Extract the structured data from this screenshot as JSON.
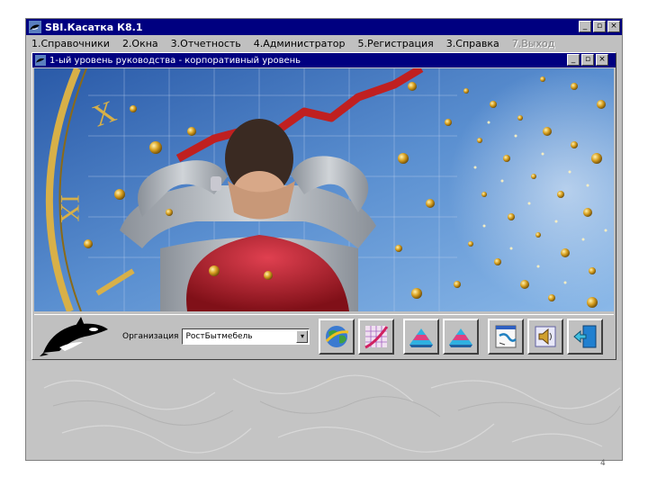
{
  "app": {
    "title": "SBI.Касатка К8.1",
    "window_controls": [
      "_",
      "▫",
      "×"
    ]
  },
  "menu": [
    {
      "label": "1.Справочники",
      "enabled": true
    },
    {
      "label": "2.Окна",
      "enabled": true
    },
    {
      "label": "3.Отчетность",
      "enabled": true
    },
    {
      "label": "4.Администратор",
      "enabled": true
    },
    {
      "label": "5.Регистрация",
      "enabled": true
    },
    {
      "label": "3.Справка",
      "enabled": true
    },
    {
      "label": "7.Выход",
      "enabled": false
    }
  ],
  "child_window": {
    "title": "1-ый уровень руководства - корпоративный уровень",
    "window_controls": [
      "_",
      "▫",
      "×"
    ]
  },
  "toolbar": {
    "org_label": "Организация",
    "org_value": "РостБытмебель",
    "buttons": [
      {
        "name": "globe-button",
        "icon": "globe-icon"
      },
      {
        "name": "chart-button",
        "icon": "growth-chart-icon"
      },
      {
        "name": "pyramid-button-1",
        "icon": "pyramid-icon"
      },
      {
        "name": "pyramid-button-2",
        "icon": "pyramid-icon"
      },
      {
        "name": "notes-button",
        "icon": "notes-icon"
      },
      {
        "name": "sound-button",
        "icon": "speaker-icon"
      },
      {
        "name": "exit-button",
        "icon": "exit-door-icon"
      }
    ]
  },
  "page_number": "4",
  "colors": {
    "titlebar": "#000080",
    "face": "#c0c0c0",
    "sky": "#3a6fb8",
    "chart_line": "#c02020",
    "chair": "#b01e28"
  }
}
